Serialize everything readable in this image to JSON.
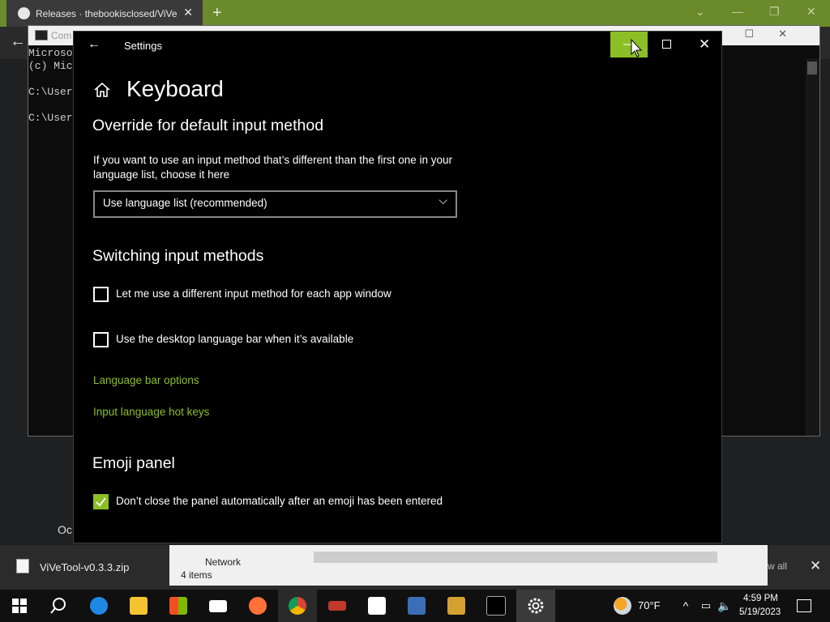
{
  "browser": {
    "tab_title": "Releases · thebookisclosed/ViVe",
    "page_partial_text": "Oc"
  },
  "cmd": {
    "title": "Com",
    "lines": "Microso\n(c) Mic\n\nC:\\User\n\nC:\\User"
  },
  "settings": {
    "window_title": "Settings",
    "page_title": "Keyboard",
    "override_heading": "Override for default input method",
    "override_desc": "If you want to use an input method that’s different than the first one in your language list, choose it here",
    "dropdown_value": "Use language list (recommended)",
    "switching_heading": "Switching input methods",
    "checkbox_app_window": "Let me use a different input method for each app window",
    "checkbox_app_window_checked": false,
    "checkbox_language_bar": "Use the desktop language bar when it’s available",
    "checkbox_language_bar_checked": false,
    "link_language_bar_options": "Language bar options",
    "link_hot_keys": "Input language hot keys",
    "emoji_heading": "Emoji panel",
    "checkbox_emoji": "Don’t close the panel automatically after an emoji has been entered",
    "checkbox_emoji_checked": true
  },
  "explorer": {
    "nav_item": "Network",
    "item_count": "4 items"
  },
  "download_bar": {
    "file_name": "ViVeTool-v0.3.3.zip",
    "show_all": "w all"
  },
  "taskbar": {
    "weather_temp": "70°F",
    "time": "4:59 PM",
    "date": "5/19/2023"
  },
  "colors": {
    "accent": "#8cbf26",
    "settings_bg": "#000000",
    "taskbar_bg": "#101010"
  }
}
